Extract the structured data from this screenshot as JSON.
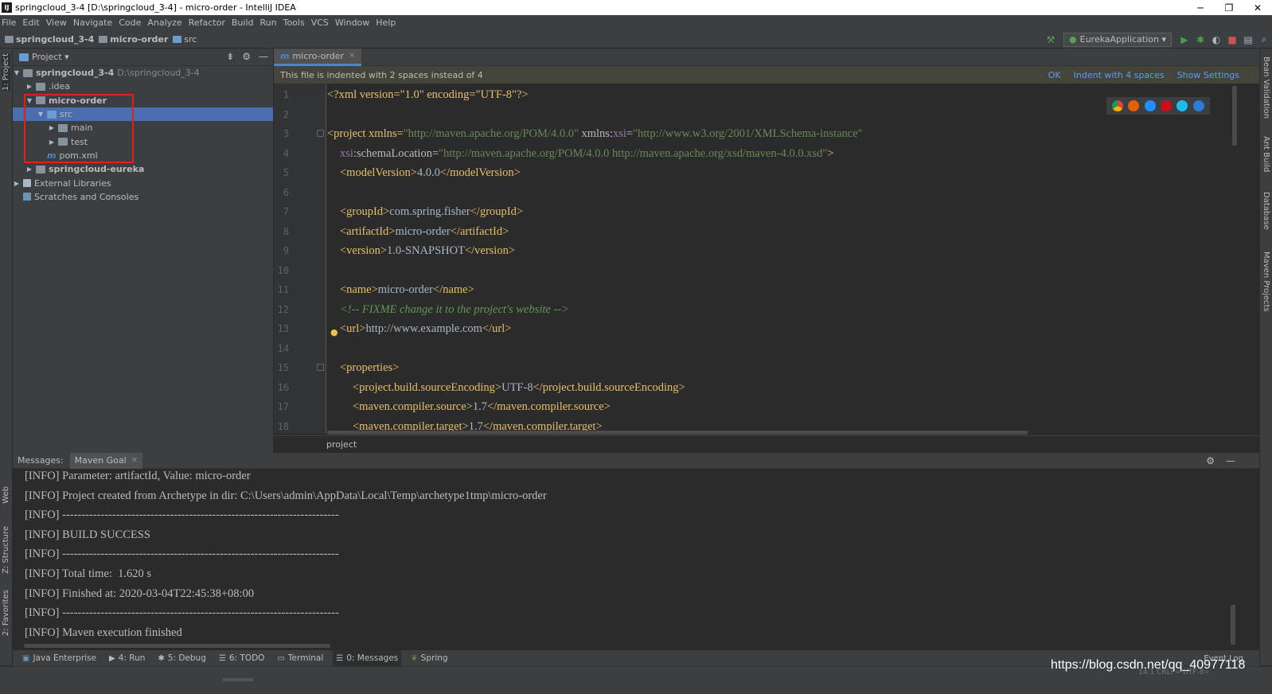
{
  "window": {
    "title": "springcloud_3-4 [D:\\springcloud_3-4] - micro-order - IntelliJ IDEA",
    "app_icon": "IJ",
    "minimize": "─",
    "restore": "❐",
    "close": "✕"
  },
  "menu": [
    "File",
    "Edit",
    "View",
    "Navigate",
    "Code",
    "Analyze",
    "Refactor",
    "Build",
    "Run",
    "Tools",
    "VCS",
    "Window",
    "Help"
  ],
  "breadcrumb": {
    "project": "springcloud_3-4",
    "module": "micro-order",
    "folder": "src"
  },
  "run_config": "EurekaApplication ▾",
  "project_panel": {
    "title": "Project ▾",
    "tree": [
      {
        "label": "springcloud_3-4",
        "path": "D:\\springcloud_3-4"
      },
      {
        "label": ".idea"
      },
      {
        "label": "micro-order"
      },
      {
        "label": "src"
      },
      {
        "label": "main"
      },
      {
        "label": "test"
      },
      {
        "label": "pom.xml"
      },
      {
        "label": "springcloud-eureka"
      },
      {
        "label": "External Libraries"
      },
      {
        "label": "Scratches and Consoles"
      }
    ]
  },
  "editor": {
    "tab_label": "micro-order",
    "notification": "This file is indented with 2 spaces instead of 4",
    "notif_actions": {
      "ok": "OK",
      "indent": "Indent with 4 spaces",
      "settings": "Show Settings"
    },
    "line_numbers": [
      "1",
      "2",
      "3",
      "4",
      "5",
      "6",
      "7",
      "8",
      "9",
      "10",
      "11",
      "12",
      "13",
      "14",
      "15",
      "16",
      "17",
      "18"
    ],
    "breadcrumb": "project",
    "code": {
      "l1": "<?xml version=\"1.0\" encoding=\"UTF-8\"?>",
      "l3a": "<project xmlns=",
      "l3b": "\"http://maven.apache.org/POM/4.0.0\"",
      "l3c": " xmlns:",
      "l3d": "xsi",
      "l3e": "=",
      "l3f": "\"http://www.w3.org/2001/XMLSchema-instance\"",
      "l4a": "xsi",
      "l4b": ":schemaLocation=",
      "l4c": "\"http://maven.apache.org/POM/4.0.0 http://maven.apache.org/xsd/maven-4.0.0.xsd\"",
      "l4d": ">",
      "l5": [
        "<modelVersion>",
        "4.0.0",
        "</modelVersion>"
      ],
      "l7": [
        "<groupId>",
        "com.spring.fisher",
        "</groupId>"
      ],
      "l8": [
        "<artifactId>",
        "micro-order",
        "</artifactId>"
      ],
      "l9": [
        "<version>",
        "1.0-SNAPSHOT",
        "</version>"
      ],
      "l11": [
        "<name>",
        "micro-order",
        "</name>"
      ],
      "l12": "<!-- FIXME change it to the project's website -->",
      "l13": [
        "<url>",
        "http://www.example.com",
        "</url>"
      ],
      "l15": "<properties>",
      "l16": [
        "<project.build.sourceEncoding>",
        "UTF-8",
        "</project.build.sourceEncoding>"
      ],
      "l17": [
        "<maven.compiler.source>",
        "1.7",
        "</maven.compiler.source>"
      ],
      "l18": [
        "<maven.compiler.target>",
        "1.7",
        "</maven.compiler.target>"
      ]
    }
  },
  "messages": {
    "label": "Messages:",
    "tab": "Maven Goal",
    "lines": [
      "[INFO] Parameter: artifactId, Value: micro-order",
      "[INFO] Project created from Archetype in dir: C:\\Users\\admin\\AppData\\Local\\Temp\\archetype1tmp\\micro-order",
      "[INFO] ------------------------------------------------------------------------",
      "[INFO] BUILD SUCCESS",
      "[INFO] ------------------------------------------------------------------------",
      "[INFO] Total time:  1.620 s",
      "[INFO] Finished at: 2020-03-04T22:45:38+08:00",
      "[INFO] ------------------------------------------------------------------------",
      "[INFO] Maven execution finished"
    ]
  },
  "tool_windows": [
    "Java Enterprise",
    "4: Run",
    "5: Debug",
    "6: TODO",
    "Terminal",
    "0: Messages",
    "Spring"
  ],
  "event_log": "Event Log",
  "left_stripe": [
    "1: Project",
    "Web",
    "Z: Structure",
    "2: Favorites"
  ],
  "right_stripe": [
    "Bean Validation",
    "Ant Build",
    "Database",
    "Maven Projects"
  ],
  "status_right": "14:1  CRLF÷  UTF-8÷",
  "watermark": "https://blog.csdn.net/qq_40977118",
  "colors": {
    "bg": "#2b2b2b",
    "panel": "#3c3f41",
    "selection": "#4b6eaf",
    "tag": "#e8bf6a",
    "string": "#6a8759",
    "comment": "#629755",
    "highlight_box": "#e02020"
  }
}
